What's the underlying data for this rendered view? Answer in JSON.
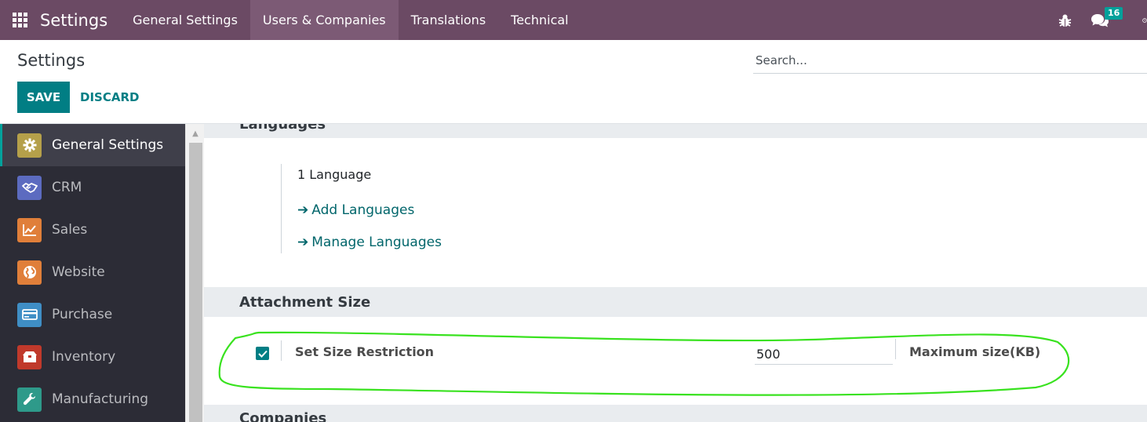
{
  "navbar": {
    "brand": "Settings",
    "menu": [
      "General Settings",
      "Users & Companies",
      "Translations",
      "Technical"
    ],
    "active_menu_index": 1,
    "chat_badge": "16",
    "icons": [
      "apps-grid-icon",
      "bug-icon",
      "chat-icon",
      "clock-icon"
    ]
  },
  "control_panel": {
    "title": "Settings",
    "save_label": "SAVE",
    "discard_label": "DISCARD",
    "search_placeholder": "Search..."
  },
  "sidebar": {
    "items": [
      {
        "label": "General Settings",
        "icon": "gear-icon",
        "color": "#b5a04a",
        "active": true
      },
      {
        "label": "CRM",
        "icon": "handshake-icon",
        "color": "#5c6bc0"
      },
      {
        "label": "Sales",
        "icon": "chart-icon",
        "color": "#e07f3a"
      },
      {
        "label": "Website",
        "icon": "globe-icon",
        "color": "#e07f3a"
      },
      {
        "label": "Purchase",
        "icon": "credit-card-icon",
        "color": "#3f8ec5"
      },
      {
        "label": "Inventory",
        "icon": "box-icon",
        "color": "#c0392b"
      },
      {
        "label": "Manufacturing",
        "icon": "wrench-icon",
        "color": "#2e9a8a"
      }
    ]
  },
  "content": {
    "languages": {
      "title": "Languages",
      "count": "1 Language",
      "add_link": "Add Languages",
      "manage_link": "Manage Languages"
    },
    "attachment": {
      "title": "Attachment Size",
      "checkbox_label": "Set Size Restriction",
      "checked": true,
      "value": "500",
      "unit_label": "Maximum size(KB)"
    },
    "companies": {
      "title": "Companies"
    }
  },
  "colors": {
    "navbar": "#6b4a64",
    "primary": "#017e84",
    "link": "#01666b",
    "sidebar": "#2c2c36",
    "annotation": "#39e21f"
  }
}
